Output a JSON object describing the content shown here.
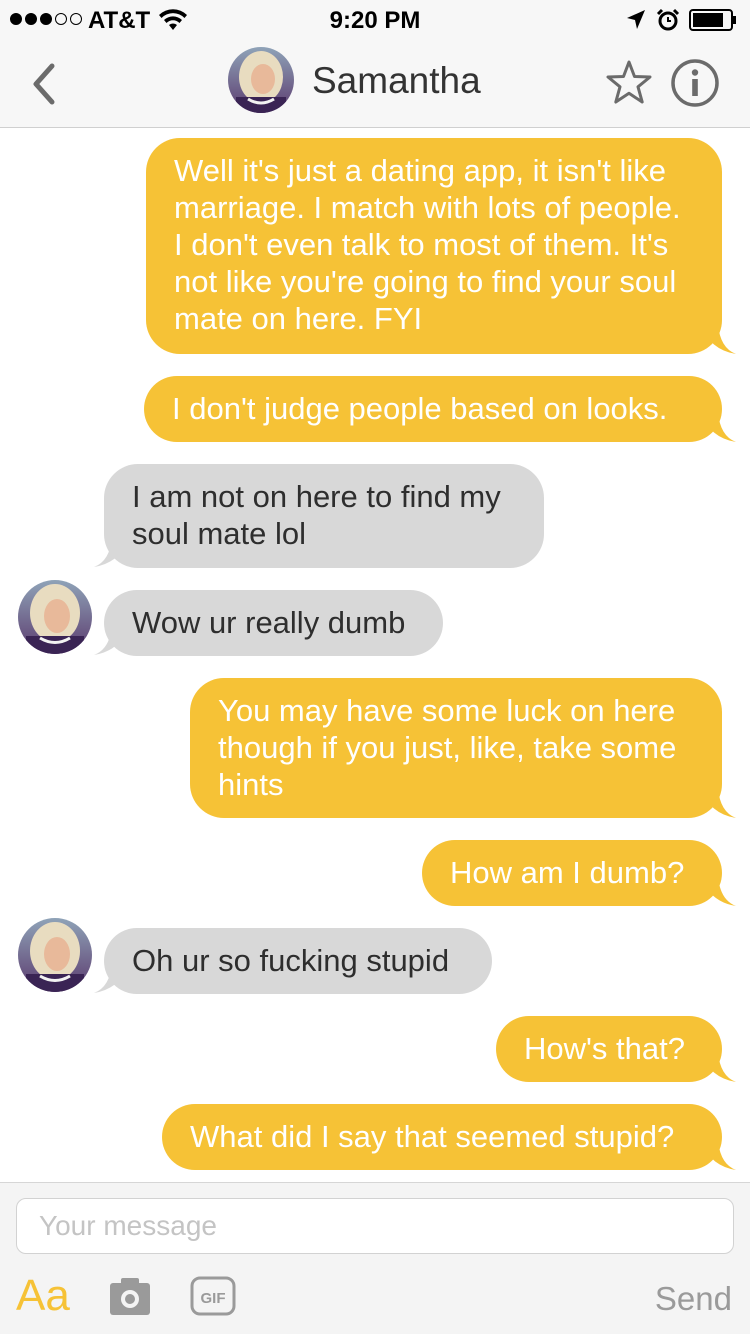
{
  "status_bar": {
    "carrier": "AT&T",
    "time": "9:20 PM",
    "signal_bars_filled": 3,
    "signal_bars_total": 5
  },
  "header": {
    "contact_name": "Samantha"
  },
  "messages": [
    {
      "direction": "outgoing",
      "text": "Well it's just a dating app, it isn't like marriage. I match with lots of people. I don't even talk to most of them. It's not like you're going to find your soul mate on here. FYI"
    },
    {
      "direction": "outgoing",
      "text": "I don't judge people based on looks."
    },
    {
      "direction": "incoming",
      "text": "I am not on here to find my soul mate lol"
    },
    {
      "direction": "incoming",
      "text": "Wow ur really dumb"
    },
    {
      "direction": "outgoing",
      "text": "You may have some luck on here though if you just, like, take some hints"
    },
    {
      "direction": "outgoing",
      "text": "How am I dumb?"
    },
    {
      "direction": "incoming",
      "text": "Oh ur so fucking stupid"
    },
    {
      "direction": "outgoing",
      "text": "How's that?"
    },
    {
      "direction": "outgoing",
      "text": "What did I say that seemed stupid?"
    }
  ],
  "composer": {
    "placeholder": "Your message",
    "font_button_label": "Aa",
    "gif_label": "GIF",
    "send_label": "Send"
  },
  "colors": {
    "outgoing_bubble": "#f6c236",
    "incoming_bubble": "#d8d8d8",
    "accent": "#f6c236"
  }
}
